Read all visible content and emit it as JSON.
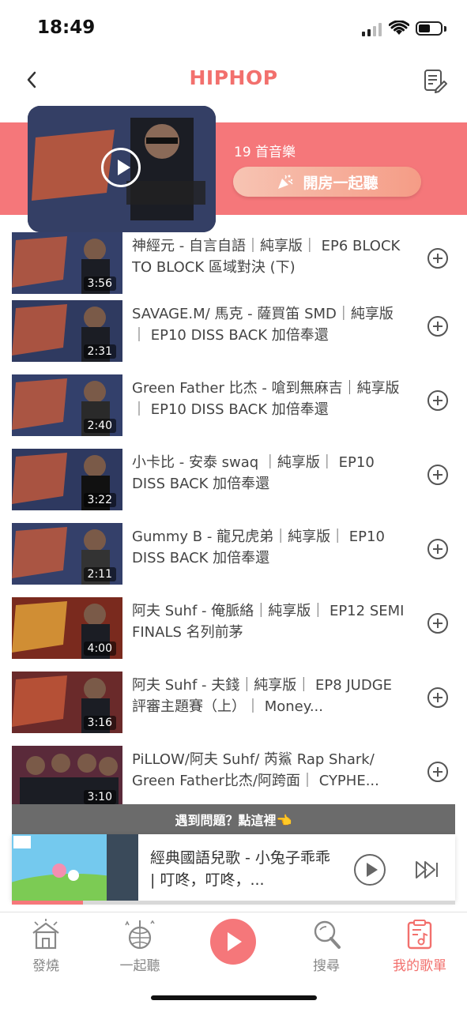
{
  "status_bar": {
    "time": "18:49"
  },
  "header": {
    "title": "HIPHOP",
    "back_icon": "chevron-left-icon",
    "edit_icon": "edit-list-icon"
  },
  "banner": {
    "song_count": "19 首音樂",
    "room_button_label": "開房一起聽",
    "room_icon": "party-popper-icon"
  },
  "songs": [
    {
      "title": "神經元 - 自言自語｜純享版｜ EP6 BLOCK TO BLOCK 區域對決 (下)",
      "duration": "3:56"
    },
    {
      "title": "SAVAGE.M/ 馬克 - 薩買笛 SMD｜純享版｜ EP10 DISS BACK 加倍奉還",
      "duration": "2:31"
    },
    {
      "title": "Green Father 比杰 - 嗆到無麻吉｜純享版｜ EP10 DISS BACK 加倍奉還",
      "duration": "2:40"
    },
    {
      "title": "小卡比 - 安泰 swaq ｜純享版｜ EP10 DISS BACK 加倍奉還",
      "duration": "3:22"
    },
    {
      "title": "Gummy B - 龍兄虎弟｜純享版｜ EP10 DISS BACK 加倍奉還",
      "duration": "2:11"
    },
    {
      "title": "阿夫 Suhf - 俺脈絡｜純享版｜ EP12 SEMI FINALS 名列前茅",
      "duration": "4:00"
    },
    {
      "title": "阿夫 Suhf - 夫錢｜純享版｜ EP8 JUDGE 評審主題賽（上）｜ Money...",
      "duration": "3:16"
    },
    {
      "title": "PiLLOW/阿夫 Suhf/ 芮鯊 Rap Shark/ Green Father比杰/阿跨面｜ CYPHE...",
      "duration": "3:10"
    }
  ],
  "problem_bar": "遇到問題？點這裡👈",
  "mini_player": {
    "title": "經典國語兒歌 - 小兔子乖乖 | 叮咚，叮咚，...",
    "progress": 0.16
  },
  "tabs": [
    {
      "label": "發燒",
      "icon": "home-icon"
    },
    {
      "label": "一起聽",
      "icon": "disco-ball-icon"
    },
    {
      "label": "",
      "icon": "play-icon"
    },
    {
      "label": "搜尋",
      "icon": "search-icon"
    },
    {
      "label": "我的歌單",
      "icon": "playlist-icon"
    }
  ],
  "colors": {
    "accent": "#f5777a",
    "title": "#f2706d",
    "problem_bar": "#6b6b6b"
  }
}
